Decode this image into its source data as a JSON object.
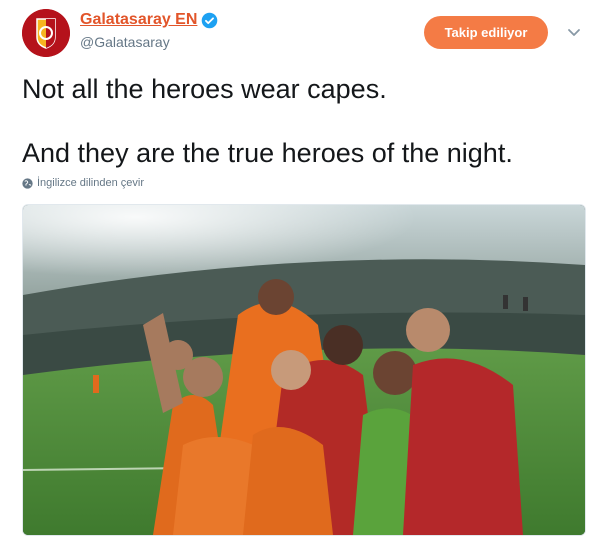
{
  "account": {
    "display_name": "Galatasaray EN",
    "handle": "@Galatasaray",
    "verified": true,
    "avatar_icon": "galatasaray-crest",
    "brand_color": "#e2552a"
  },
  "follow_button": {
    "label": "Takip ediliyor",
    "color": "#f47b45"
  },
  "menu_icon": "chevron-down",
  "tweet": {
    "line1": "Not all the heroes wear capes.",
    "line2": "And they are the true heroes of the night."
  },
  "translate": {
    "icon": "globe",
    "label": "İngilizce dilinden çevir"
  },
  "media": {
    "type": "photo",
    "icon": "team-celebration-photo"
  }
}
